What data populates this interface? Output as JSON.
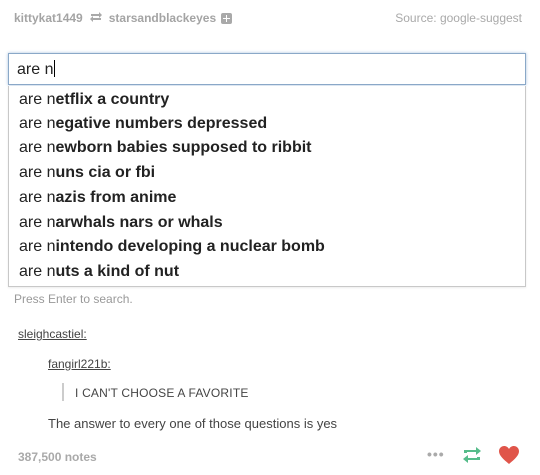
{
  "header": {
    "user_1": "kittykat1449",
    "user_2": "starsandblackeyes",
    "source": "Source: google-suggest"
  },
  "search": {
    "query": "are n"
  },
  "suggestions": [
    {
      "prefix": "are n",
      "rest": "etflix a country"
    },
    {
      "prefix": "are n",
      "rest": "egative numbers depressed"
    },
    {
      "prefix": "are n",
      "rest": "ewborn babies supposed to ribbit"
    },
    {
      "prefix": "are n",
      "rest": "uns cia or fbi"
    },
    {
      "prefix": "are n",
      "rest": "azis from anime"
    },
    {
      "prefix": "are n",
      "rest": "arwhals nars or whals"
    },
    {
      "prefix": "are n",
      "rest": "intendo developing a nuclear bomb"
    },
    {
      "prefix": "are n",
      "rest": "uts a kind of nut"
    }
  ],
  "press_enter": "Press Enter to search.",
  "thread": {
    "user_1": "sleighcastiel:",
    "user_2": "fangirl221b:",
    "quote": "I CAN'T CHOOSE A FAVORITE",
    "answer": "The answer to every one of those questions is yes"
  },
  "footer": {
    "notes": "387,500 notes",
    "more": "•••",
    "reblog_color": "#56bc8a",
    "heart_color": "#e0554a"
  }
}
